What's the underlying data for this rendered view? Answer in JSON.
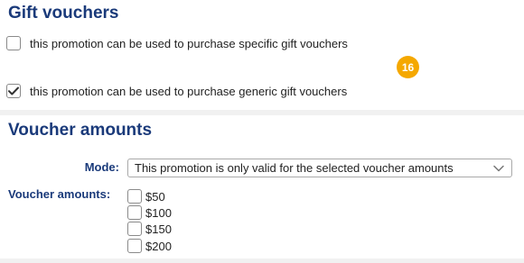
{
  "gift_vouchers": {
    "title": "Gift vouchers",
    "specific": {
      "label": "this promotion can be used to purchase specific gift vouchers",
      "checked": false
    },
    "generic": {
      "label": "this promotion can be used to purchase generic gift vouchers",
      "checked": true
    },
    "badge": "16",
    "badge_color": "#f5a800"
  },
  "voucher_amounts": {
    "title": "Voucher amounts",
    "mode_label": "Mode:",
    "mode_value": "This promotion is only valid for the selected voucher amounts",
    "amounts_label": "Voucher amounts:",
    "amounts": [
      {
        "label": "$50",
        "checked": false
      },
      {
        "label": "$100",
        "checked": false
      },
      {
        "label": "$150",
        "checked": false
      },
      {
        "label": "$200",
        "checked": false
      }
    ]
  },
  "colors": {
    "heading": "#1a3a7a"
  }
}
